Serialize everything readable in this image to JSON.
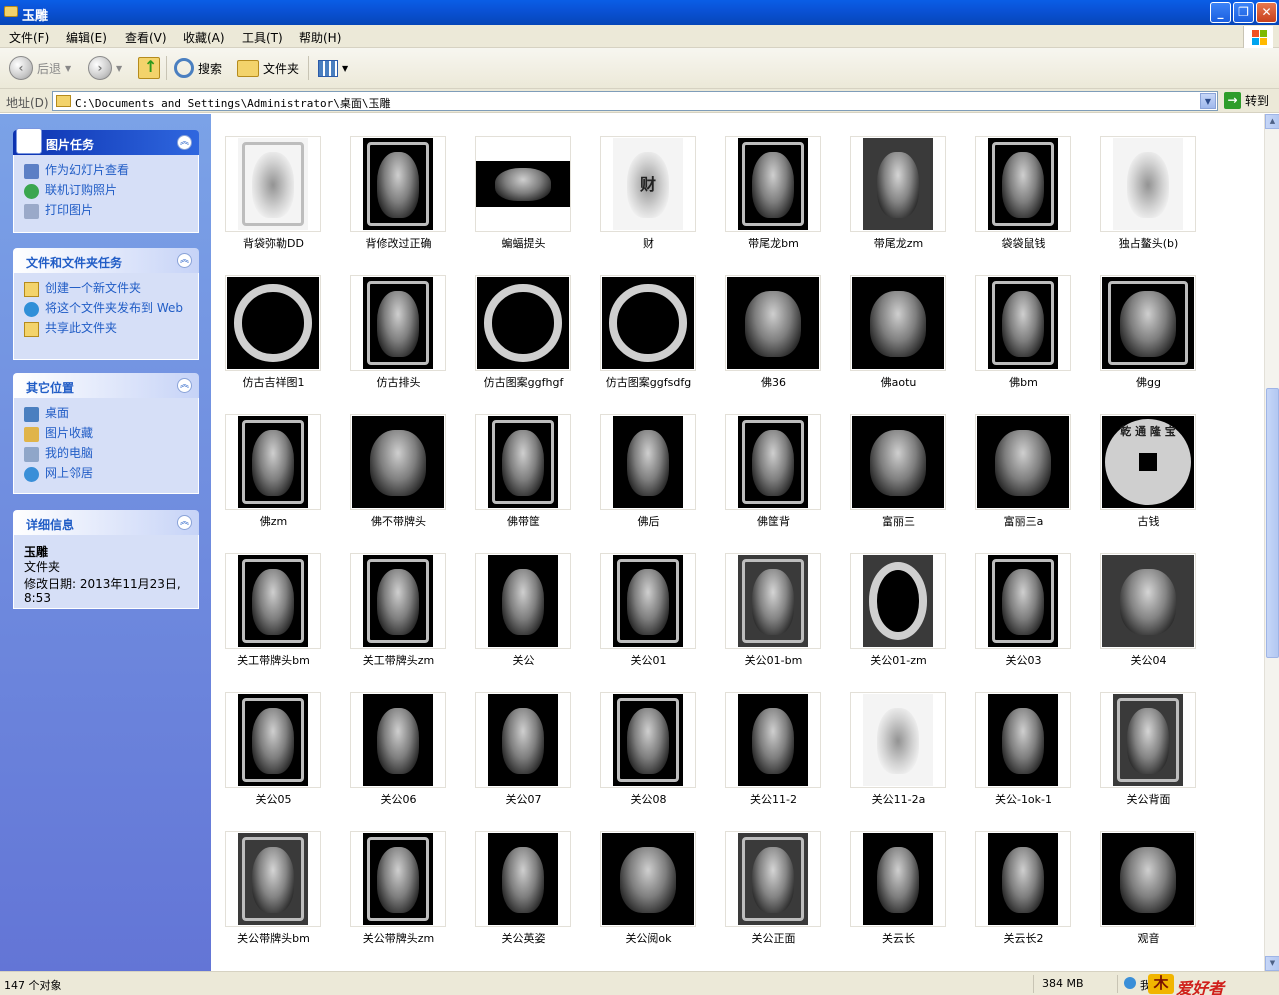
{
  "window": {
    "title": "玉雕",
    "minimize": "_",
    "restore": "❐",
    "close": "✕"
  },
  "menu": [
    "文件(F)",
    "编辑(E)",
    "查看(V)",
    "收藏(A)",
    "工具(T)",
    "帮助(H)"
  ],
  "toolbar": {
    "back": "后退",
    "search": "搜索",
    "folders": "文件夹"
  },
  "address": {
    "label": "地址(D)",
    "path": "C:\\Documents and Settings\\Administrator\\桌面\\玉雕",
    "go": "转到"
  },
  "panels": {
    "picture_tasks": {
      "title": "图片任务",
      "items": [
        "作为幻灯片查看",
        "联机订购照片",
        "打印图片"
      ]
    },
    "file_tasks": {
      "title": "文件和文件夹任务",
      "items": [
        "创建一个新文件夹",
        "将这个文件夹发布到 Web",
        "共享此文件夹"
      ]
    },
    "other_places": {
      "title": "其它位置",
      "items": [
        "桌面",
        "图片收藏",
        "我的电脑",
        "网上邻居"
      ]
    },
    "details": {
      "title": "详细信息",
      "name": "玉雕",
      "type": "文件夹",
      "modified": "修改日期: 2013年11月23日, 8:53"
    }
  },
  "files": [
    [
      "背袋弥勒DD",
      "背修改过正确",
      "蝙蝠提头",
      "财",
      "带尾龙bm",
      "带尾龙zm",
      "袋袋鼠钱",
      "独占鳌头(b)"
    ],
    [
      "仿古吉祥图1",
      "仿古排头",
      "仿古图案ggfhgf",
      "仿古图案ggfsdfg",
      "佛36",
      "佛aotu",
      "佛bm",
      "佛gg"
    ],
    [
      "佛zm",
      "佛不带牌头",
      "佛带筐",
      "佛后",
      "佛筐背",
      "富丽三",
      "富丽三a",
      "古钱"
    ],
    [
      "关工带牌头bm",
      "关工带牌头zm",
      "关公",
      "关公01",
      "关公01-bm",
      "关公01-zm",
      "关公03",
      "关公04"
    ],
    [
      "关公05",
      "关公06",
      "关公07",
      "关公08",
      "关公11-2",
      "关公11-2a",
      "关公-1ok-1",
      "关公背面"
    ],
    [
      "关公带牌头bm",
      "关公带牌头zm",
      "关公英姿",
      "关公阅ok",
      "关公正面",
      "关云长",
      "关云长2",
      "观音"
    ]
  ],
  "thumb_glyphs": {
    "cai": "财",
    "coin": "乾 通 隆 宝"
  },
  "status": {
    "count": "147 个对象",
    "size": "384 MB",
    "zone": "我",
    "watermark": "爱好者",
    "emblem": "木"
  }
}
